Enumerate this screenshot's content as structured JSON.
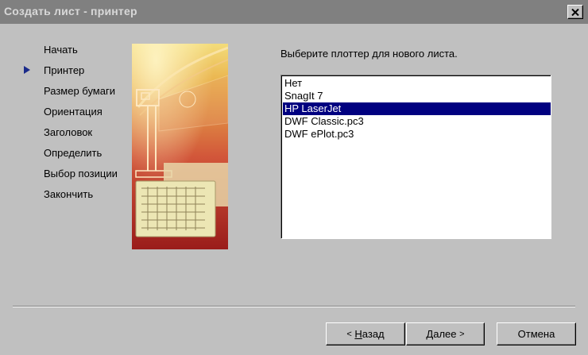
{
  "window": {
    "title": "Создать лист - принтер",
    "close_icon": "close-icon"
  },
  "steps": {
    "current_index": 1,
    "current_marker_icon": "triangle-right-icon",
    "items": [
      {
        "label": "Начать"
      },
      {
        "label": "Принтер"
      },
      {
        "label": "Размер бумаги"
      },
      {
        "label": "Ориентация"
      },
      {
        "label": "Заголовок"
      },
      {
        "label": "Определить"
      },
      {
        "label": "Выбор позиции"
      },
      {
        "label": "Закончить"
      }
    ]
  },
  "main": {
    "prompt": "Выберите плоттер для нового листа.",
    "plotters": [
      {
        "label": "Нет",
        "selected": false
      },
      {
        "label": "SnagIt 7",
        "selected": false
      },
      {
        "label": "HP LaserJet",
        "selected": true
      },
      {
        "label": "DWF Classic.pc3",
        "selected": false
      },
      {
        "label": "DWF ePlot.pc3",
        "selected": false
      }
    ]
  },
  "buttons": {
    "back_arrow": "<",
    "back_hotkey": "Н",
    "back_rest": "азад",
    "next_label": "Далее",
    "next_arrow": ">",
    "cancel": "Отмена"
  },
  "colors": {
    "selection": "#000080",
    "face": "#c0c0c0",
    "titlebar": "#808080"
  }
}
